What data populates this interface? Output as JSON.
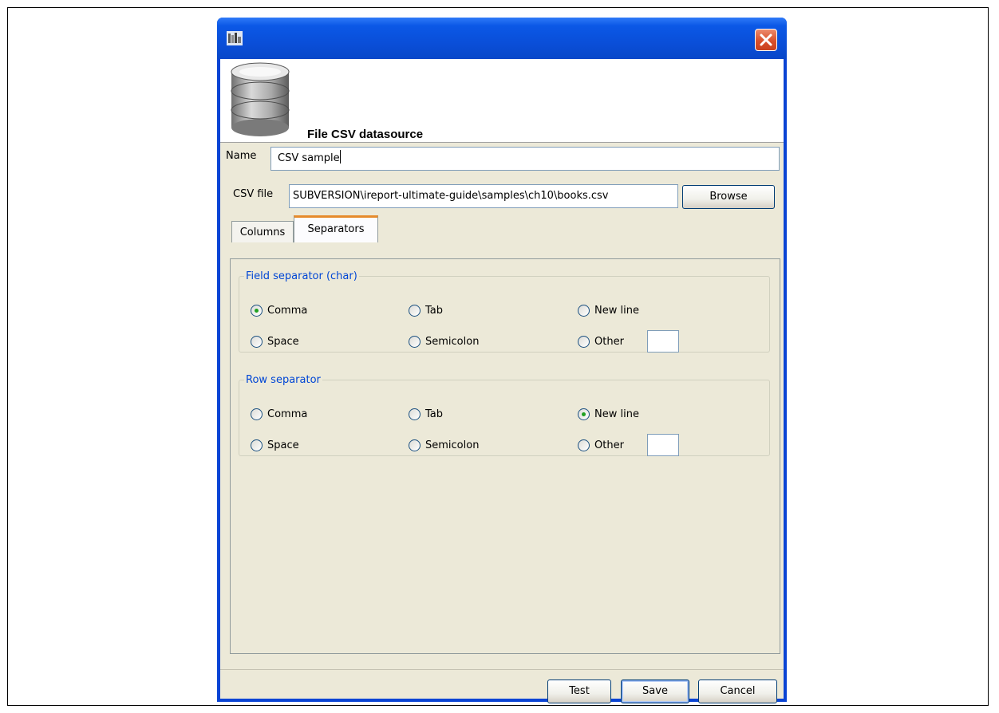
{
  "dialog": {
    "header_title": "File CSV datasource",
    "name_label": "Name",
    "name_value": "CSV sample",
    "csv_label": "CSV file",
    "csv_value": "SUBVERSION\\ireport-ultimate-guide\\samples\\ch10\\books.csv",
    "browse_label": "Browse",
    "tabs": [
      {
        "label": "Columns",
        "active": false
      },
      {
        "label": "Separators",
        "active": true
      }
    ]
  },
  "field_separator": {
    "legend": "Field separator (char)",
    "options": [
      "Comma",
      "Tab",
      "New line",
      "Space",
      "Semicolon",
      "Other"
    ],
    "selected": "Comma",
    "other_value": ""
  },
  "row_separator": {
    "legend": "Row separator",
    "options": [
      "Comma",
      "Tab",
      "New line",
      "Space",
      "Semicolon",
      "Other"
    ],
    "selected": "New line",
    "other_value": ""
  },
  "buttons": {
    "test": "Test",
    "save": "Save",
    "cancel": "Cancel"
  },
  "icons": {
    "app": "ireport-app-icon",
    "close": "close-icon",
    "header": "database-icon"
  },
  "colors": {
    "titlebar": "#0a4fd9",
    "close_button": "#d9502c",
    "legend_text": "#0046d5",
    "active_tab_accent": "#e68b2c",
    "radio_selected": "#21a121"
  }
}
